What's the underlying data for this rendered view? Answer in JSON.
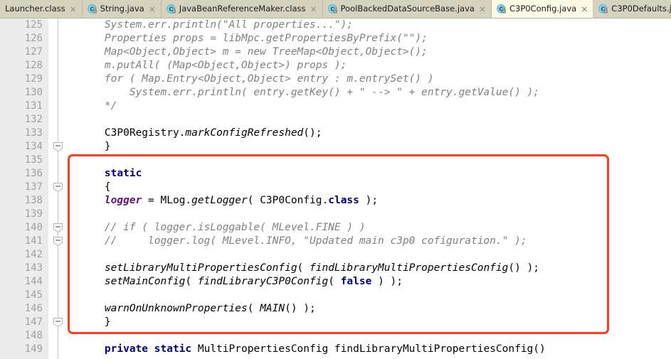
{
  "window": {
    "title": "C3P0Config.java",
    "app": "java-ide-editor"
  },
  "colors": {
    "tabbar_bg": "#d5d2bd",
    "active_tab_bg": "#fdfbe6",
    "gutter_bg": "#ececec",
    "editor_bg": "#ffffff",
    "annotation_red": "#fc3d21",
    "keyword_navy": "#000080",
    "comment_gray": "#808080",
    "field_purple": "#660e7a",
    "linenum_gray": "#a0a0a0"
  },
  "tabs": [
    {
      "label": "Launcher.class",
      "icon": "java-class-icon",
      "active": false,
      "close": "×"
    },
    {
      "label": "String.java",
      "icon": "java-class-icon",
      "active": false,
      "close": "×"
    },
    {
      "label": "JavaBeanReferenceMaker.class",
      "icon": "java-class-icon",
      "active": false,
      "close": "×"
    },
    {
      "label": "PoolBackedDataSourceBase.java",
      "icon": "java-class-icon",
      "active": false,
      "close": "×"
    },
    {
      "label": "C3P0Config.java",
      "icon": "java-class-icon",
      "active": true,
      "close": "×"
    },
    {
      "label": "C3P0Defaults.java",
      "icon": "java-class-icon",
      "active": false,
      "close": "×"
    }
  ],
  "editor": {
    "first_line_number": 125,
    "line_numbers": [
      "125",
      "126",
      "127",
      "128",
      "129",
      "130",
      "131",
      "132",
      "133",
      "134",
      "135",
      "136",
      "137",
      "138",
      "139",
      "140",
      "141",
      "142",
      "143",
      "144",
      "145",
      "146",
      "147",
      "148",
      "149"
    ],
    "fold_markers": [
      {
        "line": "134",
        "state": "expanded",
        "glyph": "−"
      },
      {
        "line": "137",
        "state": "expanded",
        "glyph": "−"
      },
      {
        "line": "140",
        "state": "expanded",
        "glyph": "−"
      },
      {
        "line": "141",
        "state": "expanded",
        "glyph": "−"
      },
      {
        "line": "147",
        "state": "expanded",
        "glyph": "−"
      }
    ],
    "lines": [
      {
        "n": "125",
        "indent": 4,
        "tokens": [
          {
            "t": "System.err.println(\"All properties...\");",
            "c": "cmt"
          }
        ]
      },
      {
        "n": "126",
        "indent": 4,
        "tokens": [
          {
            "t": "Properties props = libMpc.getPropertiesByPrefix(\"\");",
            "c": "cmt"
          }
        ]
      },
      {
        "n": "127",
        "indent": 4,
        "tokens": [
          {
            "t": "Map<Object,Object> m = new TreeMap<Object,Object>();",
            "c": "cmt"
          }
        ]
      },
      {
        "n": "128",
        "indent": 4,
        "tokens": [
          {
            "t": "m.putAll( (Map<Object,Object>) props );",
            "c": "cmt"
          }
        ]
      },
      {
        "n": "129",
        "indent": 4,
        "tokens": [
          {
            "t": "for ( Map.Entry<Object,Object> entry : m.entrySet() )",
            "c": "cmt"
          }
        ]
      },
      {
        "n": "130",
        "indent": 4,
        "tokens": [
          {
            "t": "    System.err.println( entry.getKey() + \" --> \" + entry.getValue() );",
            "c": "cmt"
          }
        ]
      },
      {
        "n": "131",
        "indent": 4,
        "tokens": [
          {
            "t": "*/",
            "c": "cmt"
          }
        ]
      },
      {
        "n": "132",
        "indent": 0,
        "tokens": []
      },
      {
        "n": "133",
        "indent": 4,
        "tokens": [
          {
            "t": "C3P0Registry.",
            "c": "plain"
          },
          {
            "t": "markConfigRefreshed",
            "c": "meth"
          },
          {
            "t": "();",
            "c": "plain"
          }
        ]
      },
      {
        "n": "134",
        "indent": 4,
        "tokens": [
          {
            "t": "}",
            "c": "plain"
          }
        ]
      },
      {
        "n": "135",
        "indent": 0,
        "tokens": []
      },
      {
        "n": "136",
        "indent": 4,
        "tokens": [
          {
            "t": "static",
            "c": "kw"
          }
        ]
      },
      {
        "n": "137",
        "indent": 4,
        "tokens": [
          {
            "t": "{",
            "c": "plain"
          }
        ]
      },
      {
        "n": "138",
        "indent": 4,
        "tokens": [
          {
            "t": "logger",
            "c": "fld"
          },
          {
            "t": " = MLog.",
            "c": "plain"
          },
          {
            "t": "getLogger",
            "c": "meth"
          },
          {
            "t": "( C3P0Config.",
            "c": "plain"
          },
          {
            "t": "class",
            "c": "kw"
          },
          {
            "t": " );",
            "c": "plain"
          }
        ]
      },
      {
        "n": "139",
        "indent": 0,
        "tokens": []
      },
      {
        "n": "140",
        "indent": 4,
        "tokens": [
          {
            "t": "// if ( logger.isLoggable( MLevel.FINE ) )",
            "c": "cmt"
          }
        ]
      },
      {
        "n": "141",
        "indent": 4,
        "tokens": [
          {
            "t": "//     logger.log( MLevel.INFO, \"Updated main c3p0 cofiguration.\" );",
            "c": "cmt"
          }
        ]
      },
      {
        "n": "142",
        "indent": 0,
        "tokens": []
      },
      {
        "n": "143",
        "indent": 4,
        "tokens": [
          {
            "t": "setLibraryMultiPropertiesConfig",
            "c": "meth"
          },
          {
            "t": "( ",
            "c": "plain"
          },
          {
            "t": "findLibraryMultiPropertiesConfig",
            "c": "meth"
          },
          {
            "t": "() );",
            "c": "plain"
          }
        ]
      },
      {
        "n": "144",
        "indent": 4,
        "tokens": [
          {
            "t": "setMainConfig",
            "c": "meth"
          },
          {
            "t": "( ",
            "c": "plain"
          },
          {
            "t": "findLibraryC3P0Config",
            "c": "meth"
          },
          {
            "t": "( ",
            "c": "plain"
          },
          {
            "t": "false",
            "c": "kw"
          },
          {
            "t": " ) );",
            "c": "plain"
          }
        ]
      },
      {
        "n": "145",
        "indent": 0,
        "tokens": []
      },
      {
        "n": "146",
        "indent": 4,
        "tokens": [
          {
            "t": "warnOnUnknownProperties",
            "c": "meth"
          },
          {
            "t": "( ",
            "c": "plain"
          },
          {
            "t": "MAIN",
            "c": "meth"
          },
          {
            "t": "() );",
            "c": "plain"
          }
        ]
      },
      {
        "n": "147",
        "indent": 4,
        "tokens": [
          {
            "t": "}",
            "c": "plain"
          }
        ]
      },
      {
        "n": "148",
        "indent": 0,
        "tokens": []
      },
      {
        "n": "149",
        "indent": 4,
        "tokens": [
          {
            "t": "private static",
            "c": "kw"
          },
          {
            "t": " MultiPropertiesConfig findLibraryMultiPropertiesConfig()",
            "c": "plain"
          }
        ]
      }
    ]
  },
  "annotation": {
    "shape": "rectangle",
    "label": "static-initializer-block-highlight",
    "covers_lines": "135-148"
  }
}
